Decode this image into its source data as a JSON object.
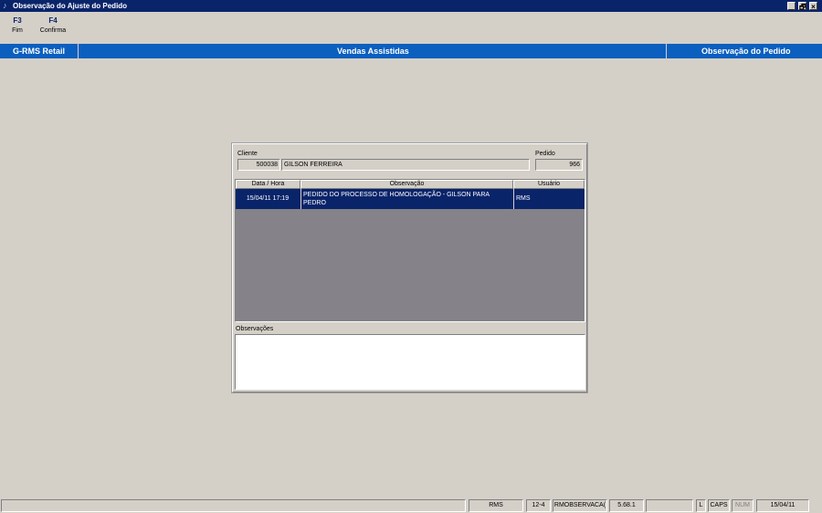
{
  "window": {
    "title": "Observação do Ajuste do Pedido",
    "controls": {
      "minimize": "_",
      "restore": "🗗",
      "close": "×"
    }
  },
  "toolbar": {
    "buttons": [
      {
        "key": "F3",
        "label": "Fim"
      },
      {
        "key": "F4",
        "label": "Confirma"
      }
    ]
  },
  "header": {
    "left": "G-RMS Retail",
    "center": "Vendas Assistidas",
    "right": "Observação do Pedido"
  },
  "form": {
    "cliente_label": "Cliente",
    "cliente_codigo": "500038",
    "cliente_nome": "GILSON FERREIRA",
    "pedido_label": "Pedido",
    "pedido_numero": "966",
    "grid": {
      "columns": [
        "Data / Hora",
        "Observação",
        "Usuário"
      ],
      "rows": [
        {
          "data_hora": "15/04/11 17:19",
          "observacao": "PEDIDO DO PROCESSO DE HOMOLOGAÇÃO - GILSON PARA PEDRO",
          "usuario": "RMS"
        }
      ]
    },
    "observacoes_label": "Observações",
    "observacoes_value": ""
  },
  "statusbar": {
    "user": "RMS",
    "code": "12-4",
    "program": "RMOBSERVACA(",
    "version": "5.68.1",
    "blank": "",
    "l": "L",
    "caps": "CAPS",
    "num": "NUM",
    "date": "15/04/11"
  },
  "colors": {
    "titlebar": "#0a246a",
    "header_bar": "#0a5fbf",
    "selection": "#0a246a",
    "grid_background": "#858289",
    "window_background": "#d4d0c8"
  }
}
